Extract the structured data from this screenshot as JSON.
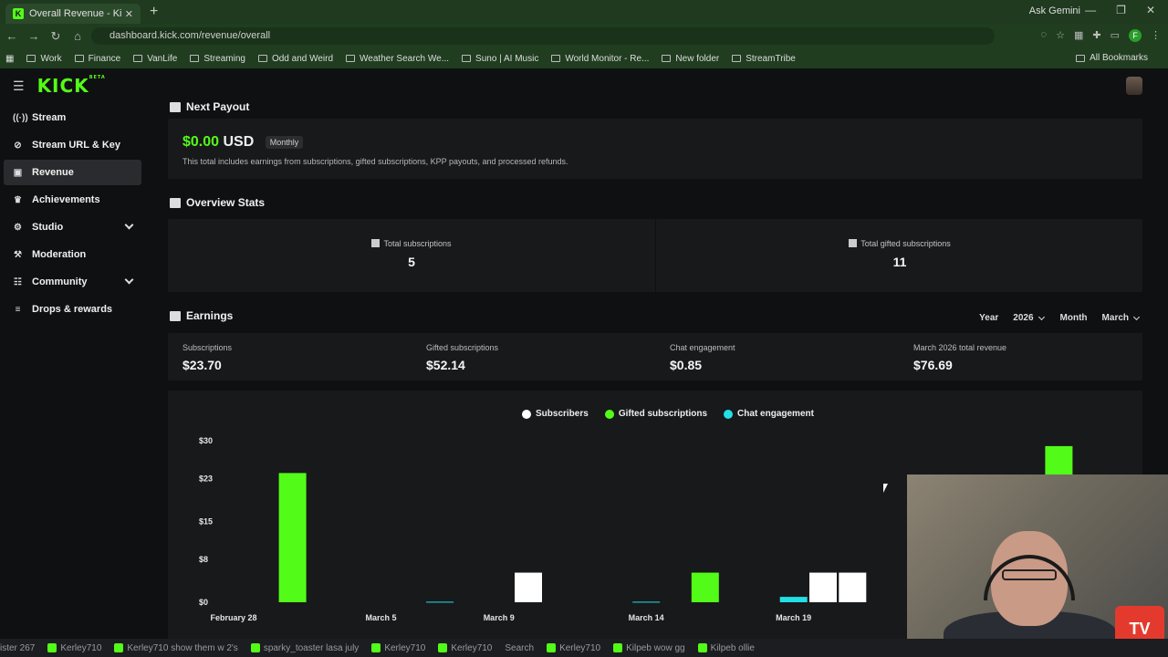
{
  "browser": {
    "tab_title": "Overall Revenue - Kick Dashbo",
    "url": "dashboard.kick.com/revenue/overall",
    "ask_gemini": "Ask Gemini",
    "bookmarks": [
      "Work",
      "Finance",
      "VanLife",
      "Streaming",
      "Odd and Weird",
      "Weather Search We...",
      "Suno | AI Music",
      "World Monitor - Re...",
      "New folder",
      "StreamTribe"
    ],
    "all_bookmarks": "All Bookmarks"
  },
  "brand": {
    "logo": "KICK",
    "badge": "BETA"
  },
  "sidebar": {
    "items": [
      {
        "label": "Stream",
        "icon": "broadcast-icon",
        "glyph": "((·))"
      },
      {
        "label": "Stream URL & Key",
        "icon": "link-icon",
        "glyph": "⊘"
      },
      {
        "label": "Revenue",
        "icon": "chart-icon",
        "glyph": "▣"
      },
      {
        "label": "Achievements",
        "icon": "trophy-icon",
        "glyph": "♛"
      },
      {
        "label": "Studio",
        "icon": "gear-icon",
        "glyph": "⚙"
      },
      {
        "label": "Moderation",
        "icon": "hammer-icon",
        "glyph": "⚒"
      },
      {
        "label": "Community",
        "icon": "people-icon",
        "glyph": "☷"
      },
      {
        "label": "Drops & rewards",
        "icon": "gift-icon",
        "glyph": "≡"
      }
    ]
  },
  "payout": {
    "title": "Next Payout",
    "amount": "$0.00",
    "currency": "USD",
    "period": "Monthly",
    "note": "This total includes earnings from subscriptions, gifted subscriptions, KPP payouts, and processed refunds."
  },
  "overview": {
    "title": "Overview Stats",
    "total_subs_label": "Total subscriptions",
    "total_subs_value": "5",
    "total_gifted_label": "Total gifted subscriptions",
    "total_gifted_value": "11"
  },
  "earnings": {
    "title": "Earnings",
    "year_label": "Year",
    "year_value": "2026",
    "month_label": "Month",
    "month_value": "March",
    "cells": [
      {
        "label": "Subscriptions",
        "value": "$23.70"
      },
      {
        "label": "Gifted subscriptions",
        "value": "$52.14"
      },
      {
        "label": "Chat engagement",
        "value": "$0.85"
      },
      {
        "label": "March 2026 total revenue",
        "value": "$76.69"
      }
    ]
  },
  "colors": {
    "accent": "#53fc18",
    "subscribers": "#ffffff",
    "gifted": "#53fc18",
    "chat": "#21e0e6",
    "card": "#18191b",
    "bg": "#0f1011"
  },
  "chart_data": {
    "type": "bar",
    "title": "",
    "xlabel": "",
    "ylabel": "",
    "ylim": [
      0,
      30
    ],
    "y_ticks": [
      "$30",
      "$23",
      "$15",
      "$8",
      "$0"
    ],
    "x_tick_labels": [
      "February 28",
      "March 5",
      "March 9",
      "March 14",
      "March 19"
    ],
    "grid": false,
    "legend": "top-center",
    "series": [
      {
        "name": "Subscribers",
        "color": "#ffffff",
        "points": [
          {
            "x": "March 10",
            "y": 5.5
          },
          {
            "x": "March 20",
            "y": 5.5
          },
          {
            "x": "March 21",
            "y": 5.5
          }
        ]
      },
      {
        "name": "Gifted subscriptions",
        "color": "#53fc18",
        "points": [
          {
            "x": "March 2",
            "y": 24
          },
          {
            "x": "March 16",
            "y": 5.5
          },
          {
            "x": "March 28",
            "y": 29
          }
        ]
      },
      {
        "name": "Chat engagement",
        "color": "#21e0e6",
        "points": [
          {
            "x": "March 7",
            "y": 0.1
          },
          {
            "x": "March 14",
            "y": 0.1
          },
          {
            "x": "March 19",
            "y": 1
          }
        ]
      }
    ]
  },
  "taskbar": {
    "items": [
      "ister 267",
      "Kerley710",
      "Kerley710 show them w 2's",
      "sparky_toaster lasa july",
      "Kerley710",
      "Kerley710",
      "Search",
      "Kerley710",
      "Kilpeb wow gg",
      "Kilpeb ollie"
    ]
  }
}
